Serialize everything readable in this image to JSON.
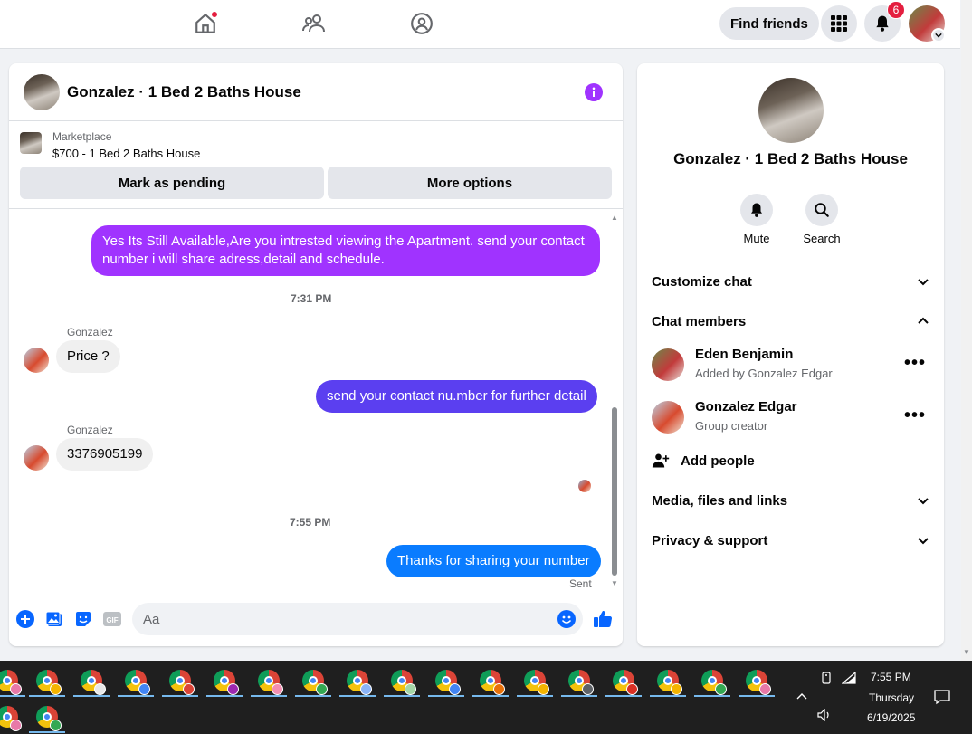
{
  "topbar": {
    "find_friends": "Find friends",
    "notifications_count": "6",
    "icons": [
      "home-icon",
      "friends-icon",
      "groups-icon",
      "menu-grid-icon",
      "bell-icon"
    ]
  },
  "chat": {
    "title": "Gonzalez · 1 Bed 2 Baths House",
    "marketplace_label": "Marketplace",
    "listing": "$700 - 1 Bed 2 Baths House",
    "mark_pending": "Mark as pending",
    "more_options": "More options",
    "messages": [
      {
        "dir": "out",
        "text": "Yes Its Still Available,Are you intrested viewing the Apartment. send your contact number i will share adress,detail and schedule.",
        "color": "#a033ff"
      },
      {
        "dir": "time",
        "text": "7:31 PM"
      },
      {
        "dir": "in",
        "sender": "Gonzalez",
        "text": "Price ?"
      },
      {
        "dir": "out",
        "text": "send your contact nu.mber for further detail",
        "color": "#5b3ff0"
      },
      {
        "dir": "in",
        "sender": "Gonzalez",
        "text": "3376905199"
      },
      {
        "dir": "time",
        "text": "7:55 PM"
      },
      {
        "dir": "out",
        "text": "Thanks for sharing your number",
        "color": "#0a7cff"
      }
    ],
    "sent_label": "Sent",
    "composer_placeholder": "Aa"
  },
  "info_panel": {
    "title": "Gonzalez · 1 Bed 2 Baths House",
    "mute": "Mute",
    "search": "Search",
    "customize_chat": "Customize chat",
    "chat_members": "Chat members",
    "members": [
      {
        "name": "Eden Benjamin",
        "sub": "Added by Gonzalez Edgar"
      },
      {
        "name": "Gonzalez Edgar",
        "sub": "Group creator"
      }
    ],
    "add_people": "Add people",
    "media": "Media, files and links",
    "privacy": "Privacy & support"
  },
  "taskbar": {
    "time": "7:55 PM",
    "day": "Thursday",
    "date": "6/19/2025"
  },
  "colors": {
    "accent_purple": "#a033ff",
    "messenger_blue": "#0a7cff",
    "facebook_blue": "#0866ff",
    "notification_red": "#e41e3f"
  }
}
